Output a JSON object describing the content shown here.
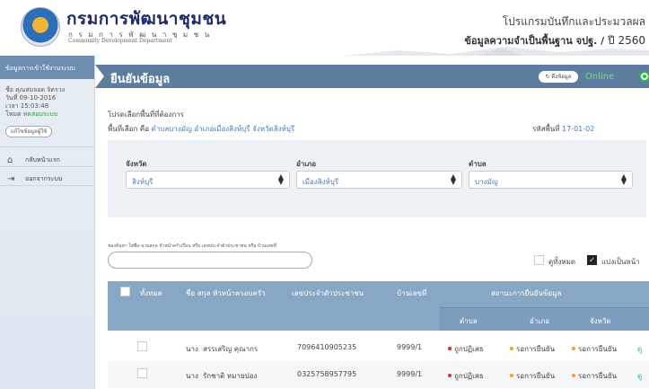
{
  "header": {
    "org_name": "กรมการพัฒนาชุมชน",
    "org_name_spaced": "ก ร ม ก า ร พั ฒ น า ชุ ม ช น",
    "org_name_en": "Community Development Department",
    "program_title": "โปรแกรมบันทึกและประมวลผล",
    "program_sub": "ข้อมูลความจำเป็นพื้นฐาน จปฐ. /",
    "program_year": "ปี 2560"
  },
  "sidebar": {
    "heading": "ข้อมูลการเข้าใช้งานระบบ",
    "user_line": "ชื่อ คุณสมจอด จิตรวง",
    "date_line": "วันที่ 09-10-2016",
    "time_line": "เวลา 15:03:48",
    "status_prefix": "โหมด",
    "status_value": "ทดสอบระบบ",
    "edit_button": "แก้ไขข้อมูลผู้ใช้",
    "items": [
      {
        "label": "กลับหน้าแรก",
        "icon": "home-icon"
      },
      {
        "label": "ออกจากระบบ",
        "icon": "logout-icon"
      }
    ]
  },
  "titlebar": {
    "title": "ยืนยันข้อมูล",
    "sync_button": "ดึงข้อมูล",
    "online_label": "Online"
  },
  "main": {
    "prompt": "โปรดเลือกพื้นที่ที่ต้องการ",
    "selected_prefix": "พื้นที่เลือก คือ",
    "selected_location": "ตำบลบางมัญ อำเภอเมืองสิงห์บุรี จังหวัดสิงห์บุรี",
    "area_code_label": "รหัสพื้นที่",
    "area_code_value": "17-01-02"
  },
  "filters": {
    "province_label": "จังหวัด",
    "province_value": "สิงห์บุรี",
    "district_label": "อำเภอ",
    "district_value": "เมืองสิงห์บุรี",
    "subdistrict_label": "ตำบล",
    "subdistrict_value": "บางมัญ"
  },
  "search": {
    "hint": "ช่องค้นหา ใส่ชื่อ-นามสกุล หัวหน้าครัวเรือน หรือ เลขประจำตัวประชาชน หรือ บ้านเลขที่",
    "placeholder": "",
    "show_all_label": "ดูทั้งหมด",
    "paginate_label": "แบ่งเป็นหน้า"
  },
  "table": {
    "headers": {
      "select_all": "ทั้งหมด",
      "name": "ชื่อ สกุล หัวหน้าครอบครัว",
      "id_number": "เลขประจำตัวประชาชน",
      "house_no": "บ้านเลขที่",
      "status_group": "สถานะการยืนยันข้อมูล",
      "status_subdistrict": "ตำบล",
      "status_district": "อำเภอ",
      "status_province": "จังหวัด"
    },
    "rows": [
      {
        "title": "นาง",
        "name": "สรรเสริญ คุณากร",
        "id": "7096410905235",
        "house": "9999/1",
        "s1": "ถูกปฏิเสธ",
        "s2": "รอการยืนยัน",
        "s3": "รอการยืนยัน",
        "more": "ดู"
      },
      {
        "title": "นาง",
        "name": "รักชาติ หมายปอง",
        "id": "0325758957795",
        "house": "9999/1",
        "s1": "ถูกปฏิเสธ",
        "s2": "รอการยืนยัน",
        "s3": "รอการยืนยัน",
        "more": "ดู"
      }
    ]
  },
  "colors": {
    "titlebar": "#5d7d9f",
    "table_header": "#87a7c4",
    "online": "#2bbb4d",
    "rejected": "#d9302f",
    "pending": "#f0a02c",
    "link": "#4a7bb5"
  }
}
